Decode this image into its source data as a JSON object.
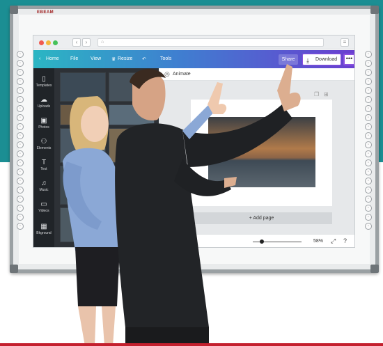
{
  "board": {
    "logo_text": "EBEAM"
  },
  "app": {
    "toolbar": {
      "home": "Home",
      "file": "File",
      "view": "View",
      "resize": "Resize",
      "tools": "Tools",
      "share": "Share",
      "download": "Download",
      "more": "•••"
    },
    "nav": [
      {
        "icon": "templates-icon",
        "label": "Templates"
      },
      {
        "icon": "uploads-icon",
        "label": "Uploads"
      },
      {
        "icon": "photos-icon",
        "label": "Photos"
      },
      {
        "icon": "elements-icon",
        "label": "Elements"
      },
      {
        "icon": "text-icon",
        "label": "Text"
      },
      {
        "icon": "music-icon",
        "label": "Music"
      },
      {
        "icon": "videos-icon",
        "label": "Videos"
      },
      {
        "icon": "background-icon",
        "label": "Bkground"
      }
    ],
    "animate_label": "Animate",
    "add_page": "+ Add page",
    "zoom": "58%"
  },
  "colors": {
    "band": "#1b8e93",
    "accent_line": "#c4202e",
    "toolbar_start": "#2bb6c3",
    "toolbar_end": "#6a3fd0"
  }
}
